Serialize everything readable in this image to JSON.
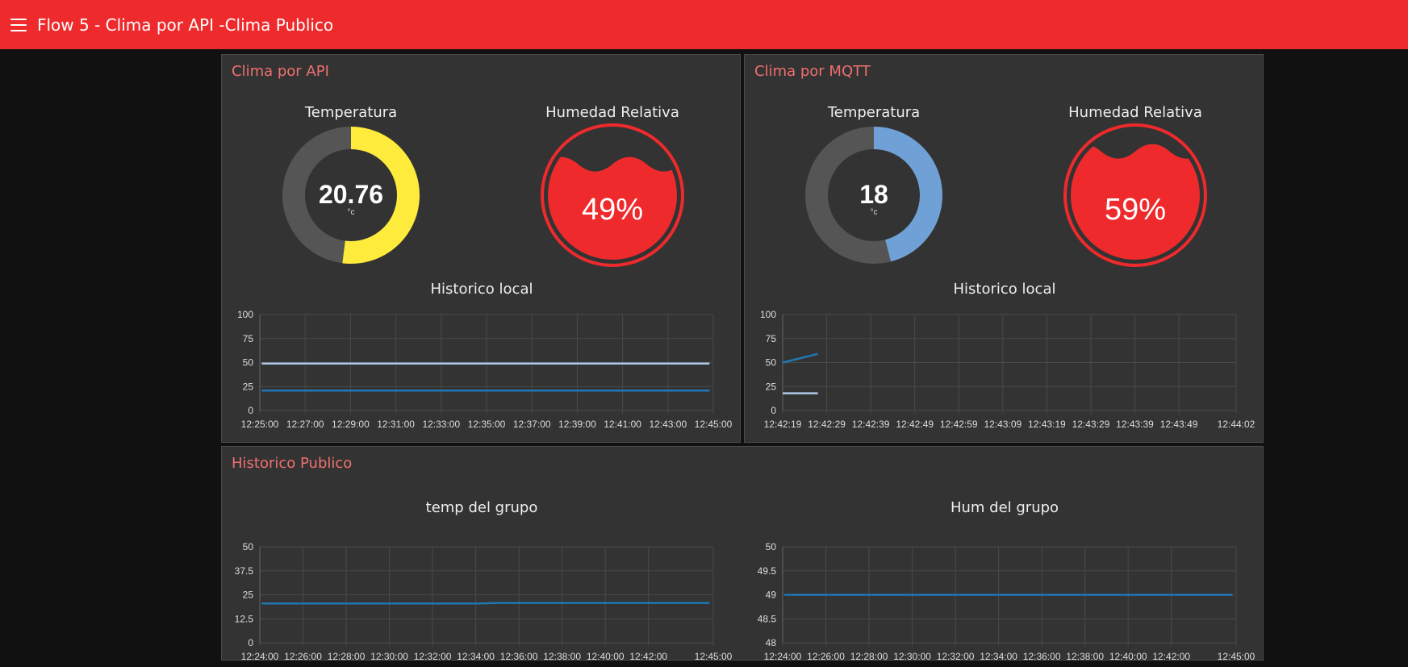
{
  "header": {
    "title": "Flow 5 - Clima por API -Clima Publico"
  },
  "colors": {
    "accent": "#ee2a2c",
    "group_title": "#f0706f",
    "gauge_yellow": "#ffeb3b",
    "gauge_blue": "#6fa1d6",
    "line_dark": "#1f77b4",
    "line_light": "#aec7e8"
  },
  "groups": {
    "api": {
      "title": "Clima por API",
      "temp": {
        "label": "Temperatura",
        "value": "20.76",
        "unit": "°c",
        "fraction": 0.52
      },
      "hum": {
        "label": "Humedad Relativa",
        "value": "49%",
        "level": 0.49
      },
      "chart_title": "Historico local"
    },
    "mqtt": {
      "title": "Clima por MQTT",
      "temp": {
        "label": "Temperatura",
        "value": "18",
        "unit": "°c",
        "fraction": 0.46
      },
      "hum": {
        "label": "Humedad Relativa",
        "value": "59%",
        "level": 0.59
      },
      "chart_title": "Historico local"
    },
    "publico": {
      "title": "Historico Publico",
      "temp_chart_title": "temp del grupo",
      "hum_chart_title": "Hum del grupo"
    }
  },
  "chart_data": [
    {
      "type": "line",
      "title": "Historico local",
      "ylim": [
        0,
        100
      ],
      "yticks": [
        "100",
        "75",
        "50",
        "25",
        "0"
      ],
      "xticks": [
        "12:25:00",
        "12:27:00",
        "12:29:00",
        "12:31:00",
        "12:33:00",
        "12:35:00",
        "12:37:00",
        "12:39:00",
        "12:41:00",
        "12:43:00",
        "12:45:00"
      ],
      "xrange": [
        "12:25:00",
        "12:45:00"
      ],
      "grid": true,
      "series": [
        {
          "color": "#aec7e8",
          "x": [
            "12:25:05",
            "12:44:50"
          ],
          "values": [
            49,
            49
          ]
        },
        {
          "color": "#1f77b4",
          "x": [
            "12:25:05",
            "12:44:50"
          ],
          "values": [
            20.76,
            20.76
          ]
        }
      ]
    },
    {
      "type": "line",
      "title": "Historico local",
      "ylim": [
        0,
        100
      ],
      "yticks": [
        "100",
        "75",
        "50",
        "25",
        "0"
      ],
      "xticks": [
        "12:42:19",
        "12:42:29",
        "12:42:39",
        "12:42:49",
        "12:42:59",
        "12:43:09",
        "12:43:19",
        "12:43:29",
        "12:43:39",
        "12:43:49",
        "12:44:02"
      ],
      "xrange": [
        "12:42:19",
        "12:44:02"
      ],
      "grid": true,
      "series": [
        {
          "color": "#1f77b4",
          "x": [
            "12:42:19",
            "12:42:27"
          ],
          "values": [
            50,
            59
          ]
        },
        {
          "color": "#aec7e8",
          "x": [
            "12:42:19",
            "12:42:27"
          ],
          "values": [
            18,
            18
          ]
        }
      ]
    },
    {
      "type": "line",
      "title": "temp del grupo",
      "ylim": [
        0,
        50
      ],
      "yticks": [
        "50",
        "37.5",
        "25",
        "12.5",
        "0"
      ],
      "xticks": [
        "12:24:00",
        "12:26:00",
        "12:28:00",
        "12:30:00",
        "12:32:00",
        "12:34:00",
        "12:36:00",
        "12:38:00",
        "12:40:00",
        "12:42:00",
        "12:45:00"
      ],
      "xrange": [
        "12:24:00",
        "12:45:00"
      ],
      "grid": true,
      "series": [
        {
          "color": "#1f77b4",
          "x": [
            "12:24:05",
            "12:34:10",
            "12:35:00",
            "12:44:50"
          ],
          "values": [
            20.5,
            20.5,
            20.76,
            20.76
          ]
        }
      ]
    },
    {
      "type": "line",
      "title": "Hum del grupo",
      "ylim": [
        48,
        50
      ],
      "yticks": [
        "50",
        "49.5",
        "49",
        "48.5",
        "48"
      ],
      "xticks": [
        "12:24:00",
        "12:26:00",
        "12:28:00",
        "12:30:00",
        "12:32:00",
        "12:34:00",
        "12:36:00",
        "12:38:00",
        "12:40:00",
        "12:42:00",
        "12:45:00"
      ],
      "xrange": [
        "12:24:00",
        "12:45:00"
      ],
      "grid": true,
      "series": [
        {
          "color": "#1f77b4",
          "x": [
            "12:24:05",
            "12:44:50"
          ],
          "values": [
            49,
            49
          ]
        }
      ]
    }
  ]
}
